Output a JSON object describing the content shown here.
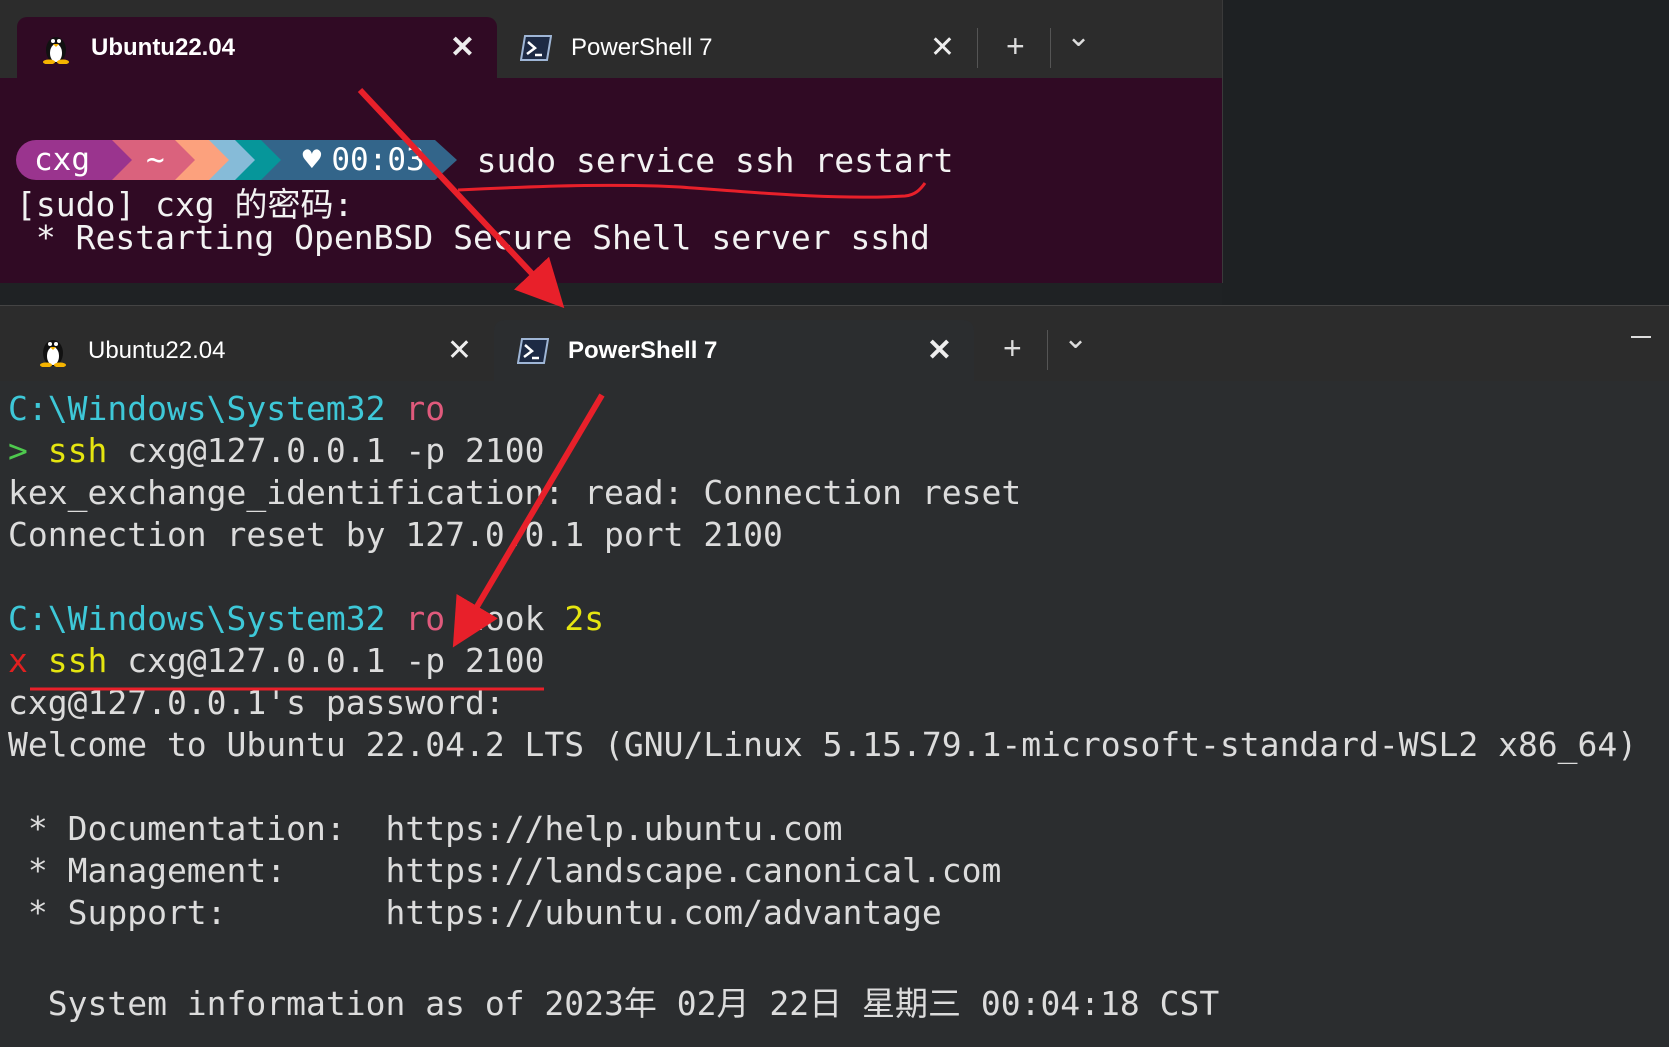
{
  "top_window": {
    "tabs": [
      {
        "label": "Ubuntu22.04",
        "icon": "tux-icon",
        "active": true
      },
      {
        "label": "PowerShell 7",
        "icon": "powershell-icon",
        "active": false
      }
    ],
    "prompt": {
      "user": "cxg",
      "dir": "~",
      "time": "00:03",
      "heart": "♥"
    },
    "command": "sudo service ssh restart",
    "output": [
      "[sudo] cxg 的密码:",
      " * Restarting OpenBSD Secure Shell server sshd"
    ]
  },
  "bottom_window": {
    "tabs": [
      {
        "label": "Ubuntu22.04",
        "icon": "tux-icon",
        "active": false
      },
      {
        "label": "PowerShell 7",
        "icon": "powershell-icon",
        "active": true
      }
    ],
    "prompt1": {
      "path": "C:\\Windows\\System32",
      "flag": "ro"
    },
    "cmd1": {
      "marker": ">",
      "cmd": "ssh",
      "args": "cxg@127.0.0.1 -p 2100"
    },
    "err1": "kex_exchange_identification: read: Connection reset",
    "err2": "Connection reset by 127.0.0.1 port 2100",
    "prompt2": {
      "path": "C:\\Windows\\System32",
      "flag": "ro",
      "took": "took",
      "dur": "2s"
    },
    "cmd2": {
      "marker": "x",
      "cmd": "ssh",
      "args": "cxg@127.0.0.1 -p 2100"
    },
    "out": [
      "cxg@127.0.0.1's password:",
      "Welcome to Ubuntu 22.04.2 LTS (GNU/Linux 5.15.79.1-microsoft-standard-WSL2 x86_64)",
      "",
      " * Documentation:  https://help.ubuntu.com",
      " * Management:     https://landscape.canonical.com",
      " * Support:        https://ubuntu.com/advantage",
      "",
      "  System information as of 2023年 02月 22日 星期三 00:04:18 CST"
    ]
  },
  "buttons": {
    "new_tab": "+",
    "dropdown": "⌄",
    "close": "✕"
  },
  "colors": {
    "ubuntu_bg": "#300a24",
    "ps_bg": "#2b2d2f",
    "annotation": "#e8202a"
  }
}
